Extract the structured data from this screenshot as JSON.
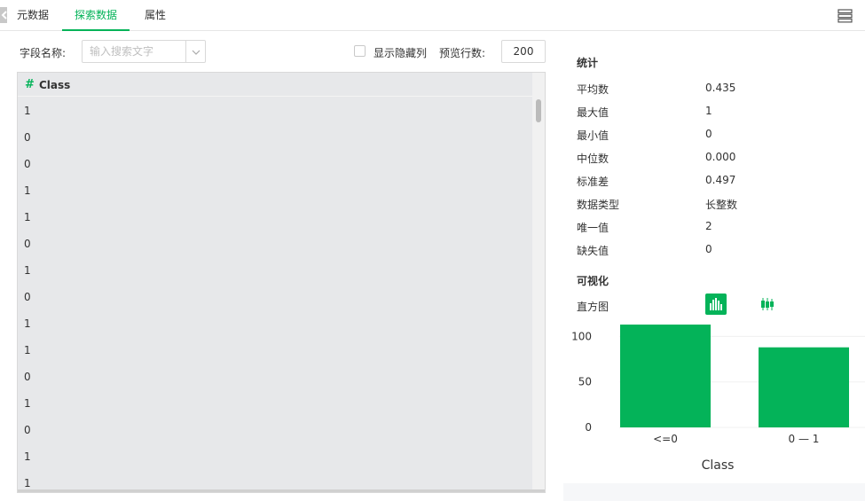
{
  "tabs": [
    {
      "label": "元数据",
      "active": false
    },
    {
      "label": "探索数据",
      "active": true
    },
    {
      "label": "属性",
      "active": false
    }
  ],
  "toolbar": {
    "field_name_label": "字段名称:",
    "search_placeholder": "输入搜索文字",
    "show_hidden_label": "显示隐藏列",
    "preview_rows_label": "预览行数:",
    "preview_rows_value": "200"
  },
  "grid": {
    "column_icon": "#",
    "column_name": "Class",
    "rows": [
      "1",
      "0",
      "0",
      "1",
      "1",
      "0",
      "1",
      "0",
      "1",
      "1",
      "0",
      "1",
      "0",
      "1",
      "1"
    ]
  },
  "stats": {
    "title": "统计",
    "items": [
      {
        "label": "平均数",
        "value": "0.435"
      },
      {
        "label": "最大值",
        "value": "1"
      },
      {
        "label": "最小值",
        "value": "0"
      },
      {
        "label": "中位数",
        "value": "0.000"
      },
      {
        "label": "标准差",
        "value": "0.497"
      },
      {
        "label": "数据类型",
        "value": "长整数"
      },
      {
        "label": "唯一值",
        "value": "2"
      },
      {
        "label": "缺失值",
        "value": "0"
      }
    ]
  },
  "visualization": {
    "title": "可视化",
    "histogram_label": "直方图",
    "accent_color": "#04b359",
    "icons": [
      "histogram-icon",
      "boxplot-icon"
    ]
  },
  "chart_data": {
    "type": "bar",
    "categories": [
      "<=0",
      "0 — 1"
    ],
    "values": [
      113,
      88
    ],
    "title": "",
    "xlabel": "Class",
    "ylabel": "",
    "yticks": [
      0,
      50,
      100
    ],
    "ylim": [
      0,
      115
    ],
    "grid": true,
    "color": "#04b359"
  }
}
